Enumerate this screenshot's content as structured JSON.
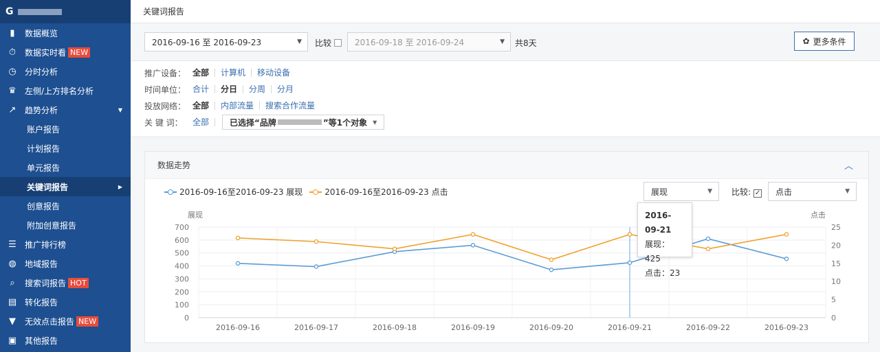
{
  "sidebar": {
    "logo_mark": "G",
    "items": [
      {
        "label": "数据概览",
        "icon": "bar-chart-icon"
      },
      {
        "label": "数据实时看",
        "icon": "stopwatch-icon",
        "badge": "NEW"
      },
      {
        "label": "分时分析",
        "icon": "clock-icon"
      },
      {
        "label": "左侧/上方排名分析",
        "icon": "trophy-icon"
      },
      {
        "label": "趋势分析",
        "icon": "trend-icon"
      }
    ],
    "sub_items": [
      "账户报告",
      "计划报告",
      "单元报告",
      "关键词报告",
      "创意报告",
      "附加创意报告"
    ],
    "items2": [
      {
        "label": "推广排行榜",
        "icon": "list-icon"
      },
      {
        "label": "地域报告",
        "icon": "globe-icon"
      },
      {
        "label": "搜索词报告",
        "icon": "search-icon",
        "badge": "HOT"
      },
      {
        "label": "转化报告",
        "icon": "clipboard-icon"
      },
      {
        "label": "无效点击报告",
        "icon": "filter-icon",
        "badge": "NEW"
      },
      {
        "label": "其他报告",
        "icon": "box-icon"
      }
    ]
  },
  "header": {
    "title": "关键词报告"
  },
  "filters": {
    "date_range": "2016-09-16 至 2016-09-23",
    "compare_label": "比较",
    "compare_range": "2016-09-18 至 2016-09-24",
    "days": "共8天",
    "more_button": "更多条件",
    "device_label": "推广设备：",
    "device_options": [
      "全部",
      "计算机",
      "移动设备"
    ],
    "time_label": "时间单位：",
    "time_options": [
      "合计",
      "分日",
      "分周",
      "分月"
    ],
    "network_label": "投放网络：",
    "network_options": [
      "全部",
      "内部流量",
      "搜索合作流量"
    ],
    "keyword_label": "关 键 词：",
    "keyword_all": "全部",
    "keyword_selected_prefix": "已选择“品牌",
    "keyword_selected_suffix": "”等1个对象"
  },
  "panel": {
    "title": "数据走势",
    "metric1_select": "展现",
    "compare_label": "比较:",
    "metric2_select": "点击",
    "tooltip": {
      "date": "2016-09-21",
      "line1": "展现：425",
      "line2": "点击：23"
    }
  },
  "colors": {
    "series1": "#5b9bd5",
    "series2": "#f0a22e",
    "sidebar": "#1d4f91"
  },
  "chart_data": {
    "type": "line",
    "categories": [
      "2016-09-16",
      "2016-09-17",
      "2016-09-18",
      "2016-09-19",
      "2016-09-20",
      "2016-09-21",
      "2016-09-22",
      "2016-09-23"
    ],
    "series": [
      {
        "name": "2016-09-16至2016-09-23 展现",
        "axis": "left",
        "values": [
          420,
          395,
          510,
          560,
          370,
          425,
          610,
          455
        ]
      },
      {
        "name": "2016-09-16至2016-09-23 点击",
        "axis": "right",
        "values": [
          22,
          21,
          19,
          23,
          16,
          23,
          19,
          23
        ]
      }
    ],
    "ylabel": "展现",
    "y2label": "点击",
    "ylim": [
      0,
      700
    ],
    "y2lim": [
      0,
      25
    ],
    "yticks": [
      0,
      100,
      200,
      300,
      400,
      500,
      600,
      700
    ],
    "y2ticks": [
      0,
      5,
      10,
      15,
      20,
      25
    ],
    "highlight_category": "2016-09-21",
    "grid": true
  }
}
